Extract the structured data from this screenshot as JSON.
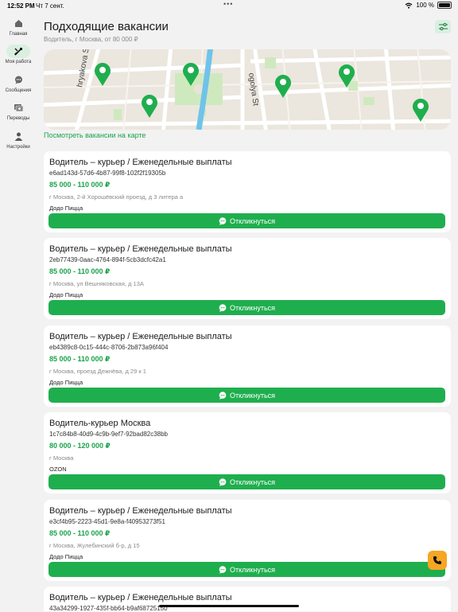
{
  "status": {
    "time": "12:52 PM",
    "date": "Чт 7 сент.",
    "dots": "•••",
    "battery": "100 %"
  },
  "sidebar": {
    "items": [
      {
        "label": "Главная",
        "icon": "home-icon"
      },
      {
        "label": "Моя работа",
        "icon": "wrench-icon",
        "active": true
      },
      {
        "label": "Сообщения",
        "icon": "chat-icon"
      },
      {
        "label": "Переводы",
        "icon": "transfer-icon"
      },
      {
        "label": "Настройки",
        "icon": "person-icon"
      }
    ]
  },
  "page": {
    "title": "Подходящие вакансии",
    "subtitle": "Водитель, г Москва, от 80 000 ₽",
    "map_link": "Посмотреть вакансии на карте"
  },
  "map": {
    "street_labels": [
      "hryakova St",
      "ogolya St"
    ]
  },
  "accent_color": "#1fae4e",
  "jobs": [
    {
      "title": "Водитель – курьер / Еженедельные выплаты",
      "id": "e6ad143d-57d6-4b87-99f8-102f2f19305b",
      "salary": "85 000 - 110 000 ₽",
      "address": "г Москва, 2-й Хорошёвский проезд, д 3 литера а",
      "company": "Додо Пицца",
      "button": "Откликнуться"
    },
    {
      "title": "Водитель – курьер / Еженедельные выплаты",
      "id": "2eb77439-0aac-4764-894f-5cb3dcfc42a1",
      "salary": "85 000 - 110 000 ₽",
      "address": "г Москва, ул Вешняковская, д 13А",
      "company": "Додо Пицца",
      "button": "Откликнуться"
    },
    {
      "title": "Водитель – курьер / Еженедельные выплаты",
      "id": "eb4389c8-0c15-444c-8706-2b873a96f404",
      "salary": "85 000 - 110 000 ₽",
      "address": "г Москва, проезд Дежнёва, д 29 к 1",
      "company": "Додо Пицца",
      "button": "Откликнуться"
    },
    {
      "title": "Водитель-курьер Москва",
      "id": "1c7c84b8-40d9-4c9b-9ef7-92bad82c38bb",
      "salary": "80 000 - 120 000 ₽",
      "address": "г Москва",
      "company": "OZON",
      "button": "Откликнуться"
    },
    {
      "title": "Водитель – курьер / Еженедельные выплаты",
      "id": "e3cf4b95-2223-45d1-9e8a-f40953273f51",
      "salary": "85 000 - 110 000 ₽",
      "address": "г Москва, Жулебинский б-р, д 15",
      "company": "Додо Пицца",
      "button": "Откликнуться"
    },
    {
      "title": "Водитель – курьер / Еженедельные выплаты",
      "id": "43a34299-1927-435f-bb64-b9af68725150"
    }
  ]
}
